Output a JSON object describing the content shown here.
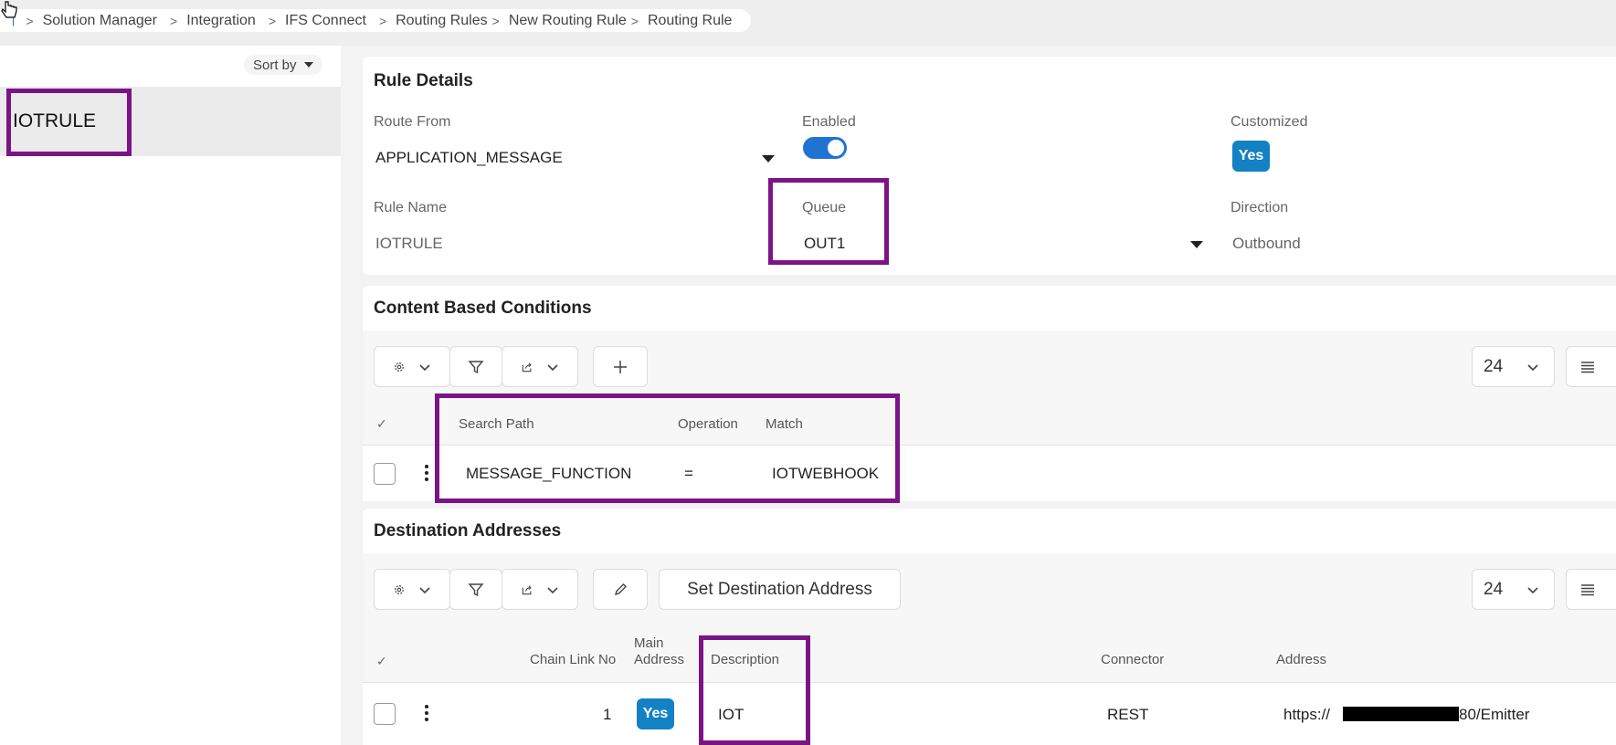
{
  "breadcrumb": {
    "items": [
      "Solution Manager",
      "Integration",
      "IFS Connect",
      "Routing Rules",
      "New Routing Rule",
      "Routing Rule"
    ]
  },
  "left_panel": {
    "sort_label": "Sort by",
    "items": [
      {
        "label": "IOTRULE"
      }
    ]
  },
  "rule_details": {
    "title": "Rule Details",
    "route_from": {
      "label": "Route From",
      "value": "APPLICATION_MESSAGE"
    },
    "enabled": {
      "label": "Enabled",
      "value": true
    },
    "customized": {
      "label": "Customized",
      "value": "Yes"
    },
    "rule_name": {
      "label": "Rule Name",
      "value": "IOTRULE"
    },
    "queue": {
      "label": "Queue",
      "value": "OUT1"
    },
    "direction": {
      "label": "Direction",
      "value": "Outbound"
    }
  },
  "conditions": {
    "title": "Content Based Conditions",
    "page_size": "24",
    "columns": [
      "Search Path",
      "Operation",
      "Match"
    ],
    "rows": [
      {
        "search_path": "MESSAGE_FUNCTION",
        "operation": "=",
        "match": "IOTWEBHOOK"
      }
    ]
  },
  "destinations": {
    "title": "Destination Addresses",
    "set_button": "Set Destination Address",
    "page_size": "24",
    "columns": {
      "chain_link_no": "Chain Link No",
      "main_address_1": "Main",
      "main_address_2": "Address",
      "description": "Description",
      "connector": "Connector",
      "address": "Address"
    },
    "rows": [
      {
        "chain_link_no": "1",
        "main_address": "Yes",
        "description": "IOT",
        "connector": "REST",
        "address_prefix": "https://",
        "address_suffix": "80/Emitter"
      }
    ]
  },
  "colors": {
    "accent": "#1f73d1",
    "badge": "#1381c3",
    "highlight": "#7b1586"
  }
}
